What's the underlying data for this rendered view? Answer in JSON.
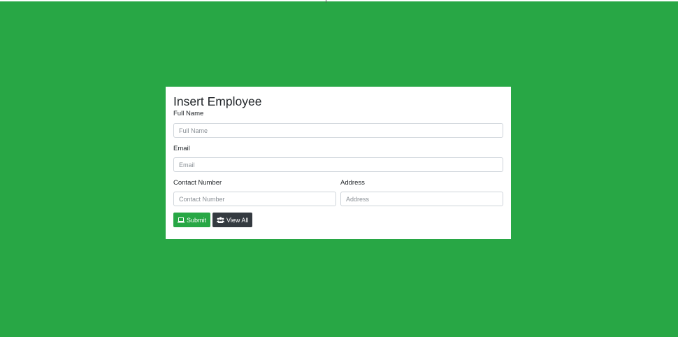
{
  "form": {
    "title": "Insert Employee",
    "full_name": {
      "label": "Full Name",
      "placeholder": "Full Name",
      "value": ""
    },
    "email": {
      "label": "Email",
      "placeholder": "Email",
      "value": ""
    },
    "contact_number": {
      "label": "Contact Number",
      "placeholder": "Contact Number",
      "value": ""
    },
    "address": {
      "label": "Address",
      "placeholder": "Address",
      "value": ""
    },
    "submit_label": "Submit",
    "submit_icon": "laptop-icon",
    "view_all_label": "View All",
    "view_all_icon": "users-icon"
  },
  "colors": {
    "background": "#28a745",
    "submit_button": "#28a745",
    "view_all_button": "#343a40",
    "card": "#ffffff"
  }
}
